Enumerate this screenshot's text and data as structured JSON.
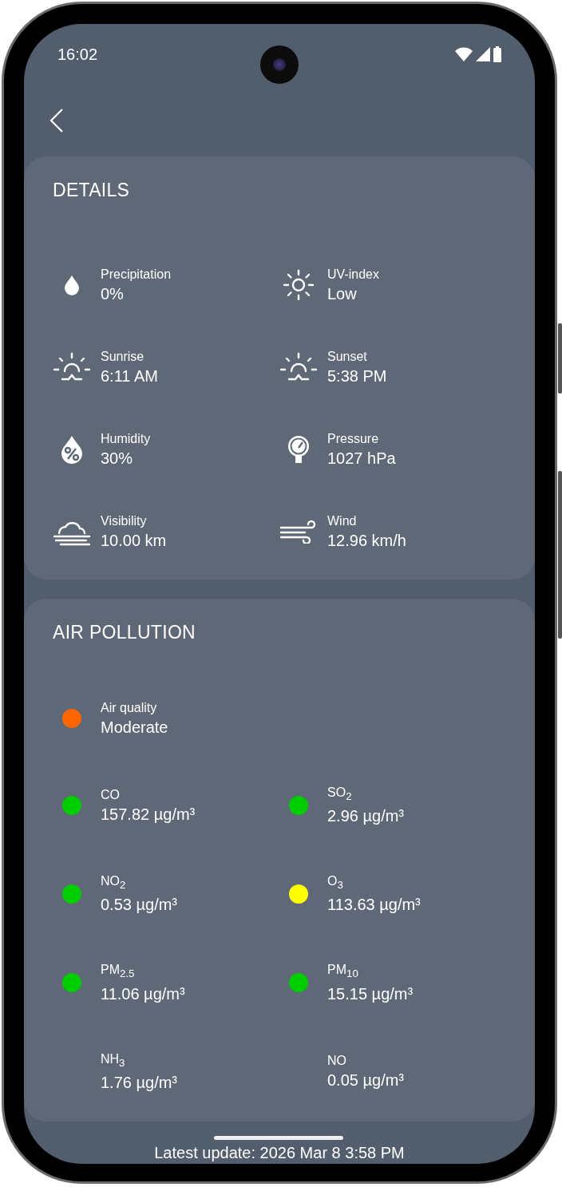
{
  "status_bar": {
    "time": "16:02"
  },
  "details": {
    "title": "DETAILS",
    "items": [
      {
        "kind": "drop",
        "label": "Precipitation",
        "value": "0%"
      },
      {
        "kind": "sun",
        "label": "UV-index",
        "value": "Low"
      },
      {
        "kind": "sunrise",
        "label": "Sunrise",
        "value": "6:11 AM"
      },
      {
        "kind": "sunset",
        "label": "Sunset",
        "value": "5:38 PM"
      },
      {
        "kind": "humidity",
        "label": "Humidity",
        "value": "30%"
      },
      {
        "kind": "gauge",
        "label": "Pressure",
        "value": "1027 hPa"
      },
      {
        "kind": "fog",
        "label": "Visibility",
        "value": "10.00 km"
      },
      {
        "kind": "wind",
        "label": "Wind",
        "value": "12.96 km/h"
      }
    ]
  },
  "air_pollution": {
    "title": "AIR POLLUTION",
    "air_quality": {
      "label": "Air quality",
      "value": "Moderate",
      "color": "#ff6600"
    },
    "items": [
      {
        "label": "CO",
        "value": "157.82 µg/m³",
        "color": "#00cc00"
      },
      {
        "label": "SO$_{2}$",
        "value": "2.96 µg/m³",
        "color": "#00cc00"
      },
      {
        "label": "NO$_{2}$",
        "value": "0.53 µg/m³",
        "color": "#00cc00"
      },
      {
        "label": "O$_{3}$",
        "value": "113.63 µg/m³",
        "color": "#ffff00"
      },
      {
        "label": "PM$_{2.5}$",
        "value": "11.06 µg/m³",
        "color": "#00cc00"
      },
      {
        "label": "PM$_{10}$",
        "value": "15.15 µg/m³",
        "color": "#00cc00"
      },
      {
        "label": "NH$_{3}$",
        "value": "1.76 µg/m³"
      },
      {
        "label": "NO",
        "value": "0.05 µg/m³"
      }
    ]
  },
  "footer": {
    "text": "Latest update: 2026 Mar 8 3:58 PM"
  }
}
